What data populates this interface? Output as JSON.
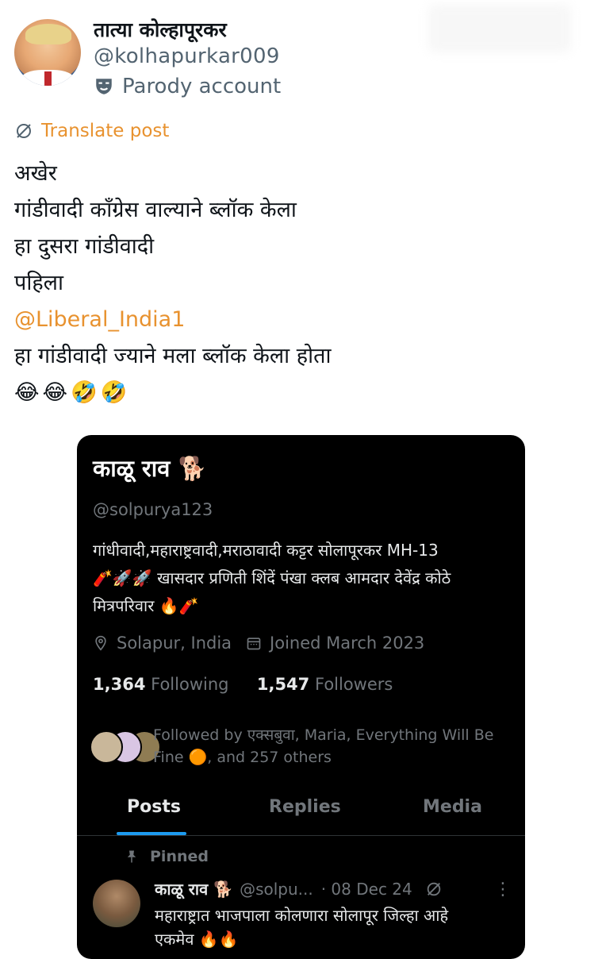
{
  "post": {
    "author_name": "तात्या कोल्हापूरकर",
    "author_handle": "@kolhapurkar009",
    "account_label": "Parody account",
    "translate_label": "Translate post",
    "lines": [
      "अखेर",
      "गांडीवादी कॉंग्रेस वाल्याने ब्लॉक केला",
      "हा दुसरा गांडीवादी",
      "पहिला"
    ],
    "mention": "@Liberal_India1",
    "after_mention": "हा गांडीवादी ज्याने मला ब्लॉक केला होता",
    "emojis": "😂😂🤣🤣",
    "colors": {
      "accent": "#e8922f",
      "secondary_text": "#536471"
    }
  },
  "profile_card": {
    "name": "काळू राव 🐕",
    "handle": "@solpurya123",
    "bio_lines": [
      "गांधीवादी,महाराष्ट्रवादी,मराठावादी  कट्टर सोलापूरकर MH-13",
      "🧨🚀🚀 खासदार प्रणिती शिंदें पंखा क्लब  आमदार देवेंद्र कोठे",
      "मित्रपरिवार 🔥🧨"
    ],
    "location": "Solapur, India",
    "joined": "Joined March 2023",
    "following_count": "1,364",
    "following_label": "Following",
    "followers_count": "1,547",
    "followers_label": "Followers",
    "followed_by": "Followed by एक्सबुवा, Maria, Everything Will Be Fine 🟠, and 257 others",
    "tabs": [
      "Posts",
      "Replies",
      "Media"
    ],
    "active_tab": "Posts",
    "pinned_label": "Pinned",
    "pinned_tweet": {
      "name": "काळू राव 🐕",
      "handle": "@solpu...",
      "date": "· 08 Dec 24",
      "text_lines": [
        "महाराष्ट्रात भाजपाला कोलणारा सोलापूर जिल्हा आहे",
        "एकमेव 🔥🔥"
      ]
    },
    "colors": {
      "background": "#000000",
      "tab_underline": "#1d9bf0",
      "muted": "#71767b"
    }
  }
}
